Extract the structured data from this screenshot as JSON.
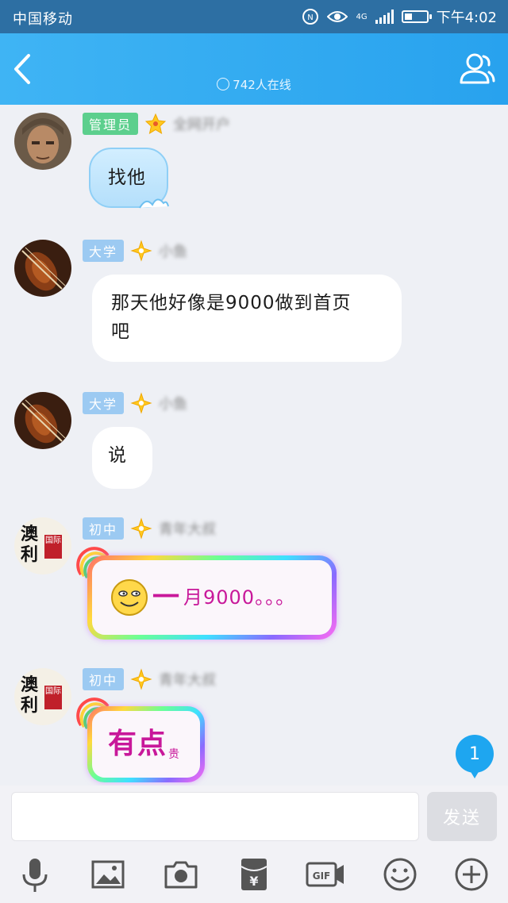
{
  "status": {
    "carrier": "中国移动",
    "network": "4G",
    "time": "下午4:02",
    "battery_level": 0.35
  },
  "header": {
    "title": "",
    "online": "742人在线"
  },
  "messages": [
    {
      "role": "管理员",
      "text": "找他"
    },
    {
      "role": "大学",
      "text": "那天他好像是9000做到首页吧",
      "line1": "那天他好像是9000做到首页",
      "line2": "吧"
    },
    {
      "role": "大学",
      "text": "说"
    },
    {
      "role": "初中",
      "text_big": "一",
      "text_rest": "月9000。。。",
      "avatar_text": "澳利",
      "avatar_seal": "国际"
    },
    {
      "role": "初中",
      "text_big": "有点",
      "text_small": "贵",
      "avatar_text": "澳利",
      "avatar_seal": "国际"
    }
  ],
  "unread_count": "1",
  "input": {
    "placeholder": "",
    "send_label": "发送"
  },
  "toolbar": [
    "mic-icon",
    "image-icon",
    "camera-icon",
    "red-packet-icon",
    "gif-icon",
    "emoji-icon",
    "plus-icon"
  ],
  "colors": {
    "accent": "#2aa6f0",
    "admin_badge": "#5ccf8d",
    "level_badge": "#9ccaf2"
  }
}
